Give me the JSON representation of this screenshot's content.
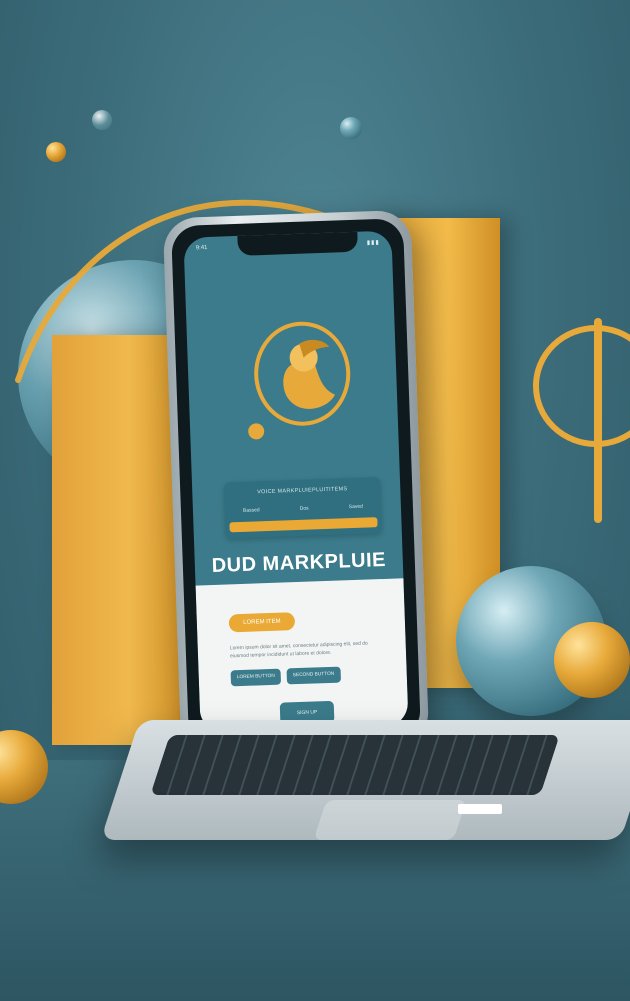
{
  "phone_ui": {
    "status_time": "9:41",
    "status_icons": "▮▮▮",
    "card": {
      "heading": "VOICE MARKPLUIEPLUITITEMS",
      "labels": [
        "Bassed",
        "Dos",
        "Saved"
      ]
    },
    "title": "DUD MARKPLUIE",
    "primary_button": "LOREM ITEM",
    "paragraph": "Lorem ipsum dolor sit amet, consectetur adipiscing elit, sed do eiusmod tempor incididunt ut labore et dolore.",
    "secondary_buttons": [
      "LOREM BUTTON",
      "SECOND BUTTON"
    ],
    "cta_button": "SIGN UP"
  },
  "colors": {
    "teal": "#3b7b8b",
    "gold": "#e9a934",
    "white_panel": "#f3f5f5"
  }
}
